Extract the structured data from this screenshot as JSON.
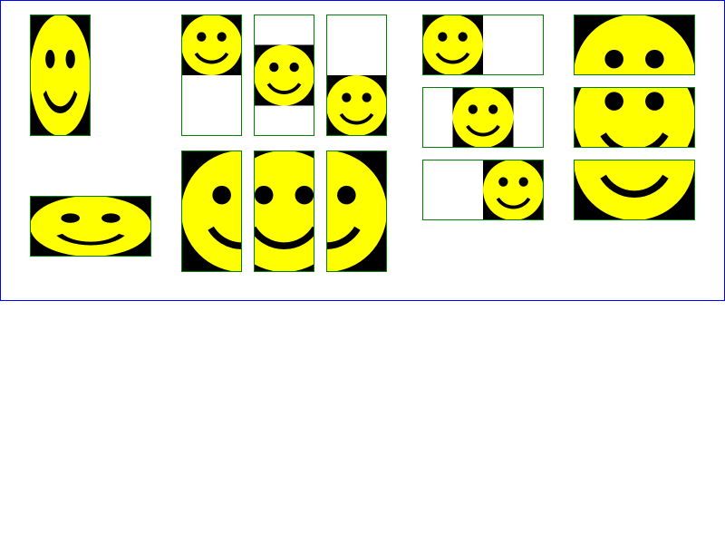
{
  "colors": {
    "face": "#ffff00",
    "features": "#000000",
    "background": "#000000",
    "frame_border": "#008000",
    "outer_border": "#0000ff",
    "page": "#ffffff"
  },
  "icon": "smiley-face-icon",
  "groups": [
    {
      "name": "stretched-smileys",
      "frames": [
        {
          "name": "tall-stretch",
          "fit": "stretch",
          "align": "none"
        },
        {
          "name": "wide-stretch",
          "fit": "stretch",
          "align": "none"
        }
      ]
    },
    {
      "name": "tall-frames-meet",
      "frames": [
        {
          "name": "meet-top",
          "fit": "meet",
          "align": "top"
        },
        {
          "name": "meet-middle",
          "fit": "meet",
          "align": "middle"
        },
        {
          "name": "meet-bottom",
          "fit": "meet",
          "align": "bottom"
        }
      ]
    },
    {
      "name": "tall-frames-slice",
      "frames": [
        {
          "name": "slice-left",
          "fit": "slice",
          "align": "left"
        },
        {
          "name": "slice-center",
          "fit": "slice",
          "align": "center"
        },
        {
          "name": "slice-right",
          "fit": "slice",
          "align": "right"
        }
      ]
    },
    {
      "name": "wide-frames-meet",
      "frames": [
        {
          "name": "meet-left",
          "fit": "meet",
          "align": "left"
        },
        {
          "name": "meet-center",
          "fit": "meet",
          "align": "center"
        },
        {
          "name": "meet-right",
          "fit": "meet",
          "align": "right"
        }
      ]
    },
    {
      "name": "wide-frames-slice",
      "frames": [
        {
          "name": "slice-top",
          "fit": "slice",
          "align": "top"
        },
        {
          "name": "slice-middle",
          "fit": "slice",
          "align": "middle"
        },
        {
          "name": "slice-bottom",
          "fit": "slice",
          "align": "bottom"
        }
      ]
    }
  ]
}
